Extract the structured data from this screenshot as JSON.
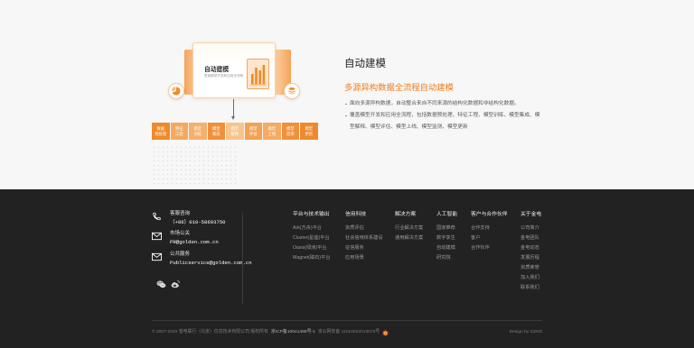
{
  "colors": {
    "accent": "#f07c1c",
    "page_bg": "#f7f7f7",
    "footer_bg": "#222222"
  },
  "feature": {
    "title": "自动建模",
    "subtitle": "多源异构数据全流程自动建模",
    "bullets": [
      "面向多源异构数据，自动整合来自不同来源的结构化数据和非结构化数据。",
      "覆盖模型开发和应用全流程，包括数据预处理、特征工程、模型训练、模型集成、模型解释、模型评估、模型上线、模型监测、模型更新"
    ],
    "illustration": {
      "card_title": "自动建模",
      "card_subtitle": "覆盖模型开发和应用全流程",
      "chart_icon": "bar-chart-icon",
      "left_icon": "pie-chart-icon",
      "right_icon": "stack-icon",
      "steps": [
        [
          "数据",
          "预处理"
        ],
        [
          "特征",
          "工程"
        ],
        [
          "模型",
          "训练"
        ],
        [
          "模型",
          "集成"
        ],
        [
          "模型",
          "解释"
        ],
        [
          "模型",
          "评估"
        ],
        [
          "模型",
          "上线"
        ],
        [
          "模型",
          "监测"
        ],
        [
          "模型",
          "更新"
        ]
      ]
    }
  },
  "footer": {
    "contacts": [
      {
        "icon": "phone-icon",
        "label": "客服咨询",
        "value": "（+86）010-58693750"
      },
      {
        "icon": "mail-icon",
        "label": "市场公关",
        "value": "PR@golden.com.cn"
      },
      {
        "icon": "mail-icon",
        "label": "公共服务",
        "value": "Publicservice@golden.com.cn"
      }
    ],
    "social": [
      "wechat-icon",
      "weibo-icon"
    ],
    "columns": [
      {
        "title": "平台与技术输出",
        "items": [
          "Ark(方舟)平台",
          "Cluster(星座)平台",
          "Oasis(绿洲)平台",
          "Magnet(磁石)平台"
        ]
      },
      {
        "title": "信用科技",
        "items": [
          "资质评估",
          "社会信用体系建设",
          "征信服务",
          "应用场景"
        ]
      },
      {
        "title": "解决方案",
        "items": [
          "行业解决方案",
          "通用解决方案"
        ]
      },
      {
        "title": "人工智能",
        "items": [
          "国家推荐",
          "数字孪生",
          "自动建模",
          "研究院"
        ]
      },
      {
        "title": "客户与合作伙伴",
        "items": [
          "合作支持",
          "客户",
          "合作伙伴"
        ]
      },
      {
        "title": "关于金电",
        "items": [
          "公司简介",
          "金电团队",
          "金电动态",
          "发展历程",
          "资质荣誉",
          "加入我们",
          "联系我们"
        ]
      }
    ],
    "copyright": {
      "text": "© 2007-2020 金电联行（北京）信息技术有限公司 版权所有",
      "icp": "京ICP备10041486号-1",
      "police": "京公网安备 11010502013676号",
      "police_icon": "police-badge-icon"
    },
    "credit": "Design by SZHD"
  }
}
